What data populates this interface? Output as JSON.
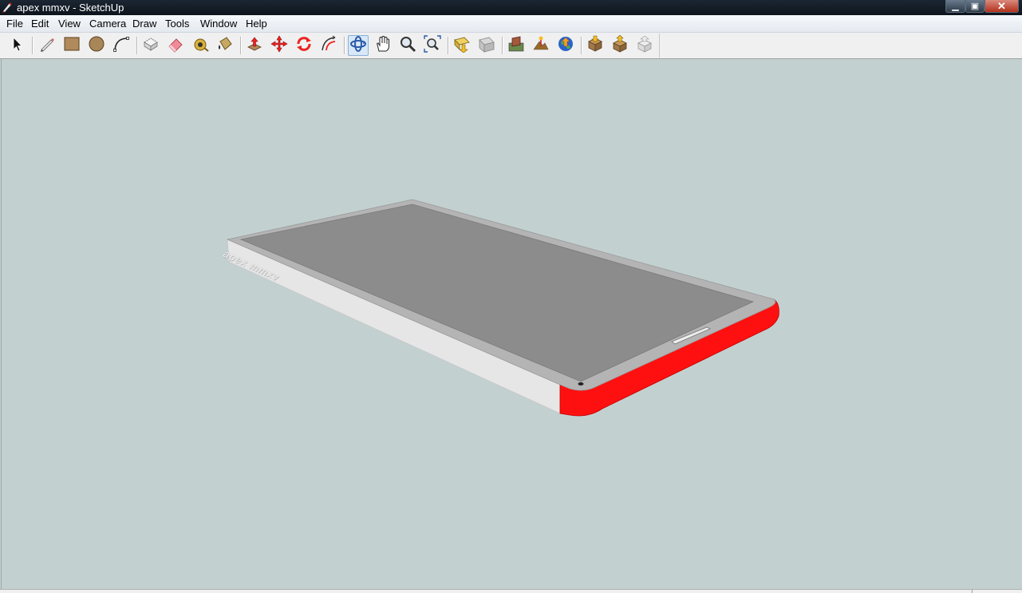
{
  "window": {
    "title": "apex mmxv - SketchUp",
    "minimize_label": "▁",
    "maximize_label": "▣",
    "close_label": "✕"
  },
  "menubar": {
    "items": [
      "File",
      "Edit",
      "View",
      "Camera",
      "Draw",
      "Tools",
      "Window",
      "Help"
    ]
  },
  "toolbar": {
    "tools": [
      {
        "name": "select-icon"
      },
      {
        "name": "pencil-icon"
      },
      {
        "name": "rectangle-icon"
      },
      {
        "name": "circle-icon"
      },
      {
        "name": "arc-icon"
      },
      {
        "name": "make-component-icon"
      },
      {
        "name": "eraser-icon"
      },
      {
        "name": "tape-measure-icon"
      },
      {
        "name": "paint-bucket-icon"
      },
      {
        "name": "push-pull-icon"
      },
      {
        "name": "move-icon"
      },
      {
        "name": "rotate-icon"
      },
      {
        "name": "offset-icon"
      },
      {
        "name": "orbit-icon"
      },
      {
        "name": "pan-icon"
      },
      {
        "name": "zoom-icon"
      },
      {
        "name": "zoom-extents-icon"
      },
      {
        "name": "previous-view-icon"
      },
      {
        "name": "next-view-icon"
      },
      {
        "name": "add-location-icon"
      },
      {
        "name": "toggle-terrain-icon"
      },
      {
        "name": "google-earth-icon"
      },
      {
        "name": "get-models-icon"
      },
      {
        "name": "share-model-icon"
      },
      {
        "name": "share-component-icon"
      }
    ],
    "active_tool": "orbit-icon"
  },
  "model": {
    "side_engraving": "apex mmxv",
    "colors": {
      "background": "#c3d0d0",
      "screen": "#8c8c8c",
      "bezel": "#b4b4b4",
      "side": "#e6e6e6",
      "accent": "#ff0000"
    }
  }
}
